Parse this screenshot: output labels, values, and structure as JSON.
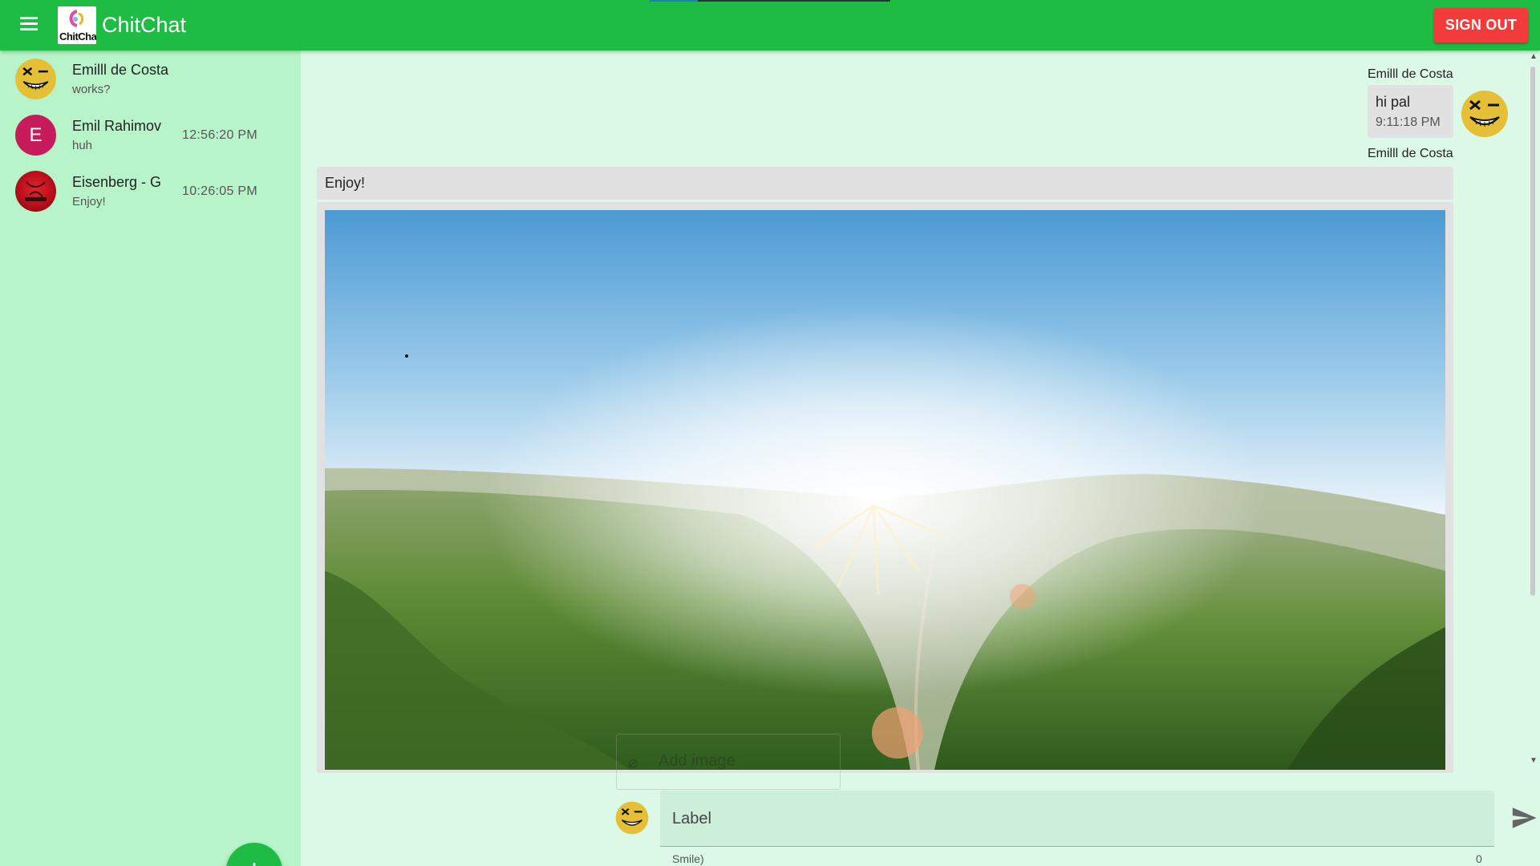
{
  "header": {
    "app_title": "ChitChat",
    "logo_text": "ChitChat",
    "signout_label": "SIGN OUT",
    "bar_color": "#1ebc45",
    "signout_color": "#f43b3b"
  },
  "sidebar": {
    "conversations": [
      {
        "name": "Emilll de Costa",
        "last_message": "works?",
        "time": "",
        "avatar": "smiley-avatar"
      },
      {
        "name": "Emil Rahimov",
        "last_message": "huh",
        "time": "12:56:20 PM",
        "avatar_letter": "E"
      },
      {
        "name": "Eisenberg - G",
        "last_message": "Enjoy!",
        "time": "10:26:05 PM",
        "avatar": "red-logo-avatar"
      }
    ],
    "fab_label": "+"
  },
  "chat": {
    "messages": [
      {
        "sender": "Emilll de Costa",
        "text": "hi pal",
        "time": "9:11:18 PM",
        "own": true
      },
      {
        "sender": "Emilll de Costa",
        "text": "Enjoy!",
        "own": false
      }
    ],
    "image_description_icon": "landscape-image"
  },
  "composer": {
    "attach_label": "Add image",
    "input_label": "Label",
    "hint": "Smile)",
    "counter": "0",
    "send_icon": "send-icon"
  }
}
